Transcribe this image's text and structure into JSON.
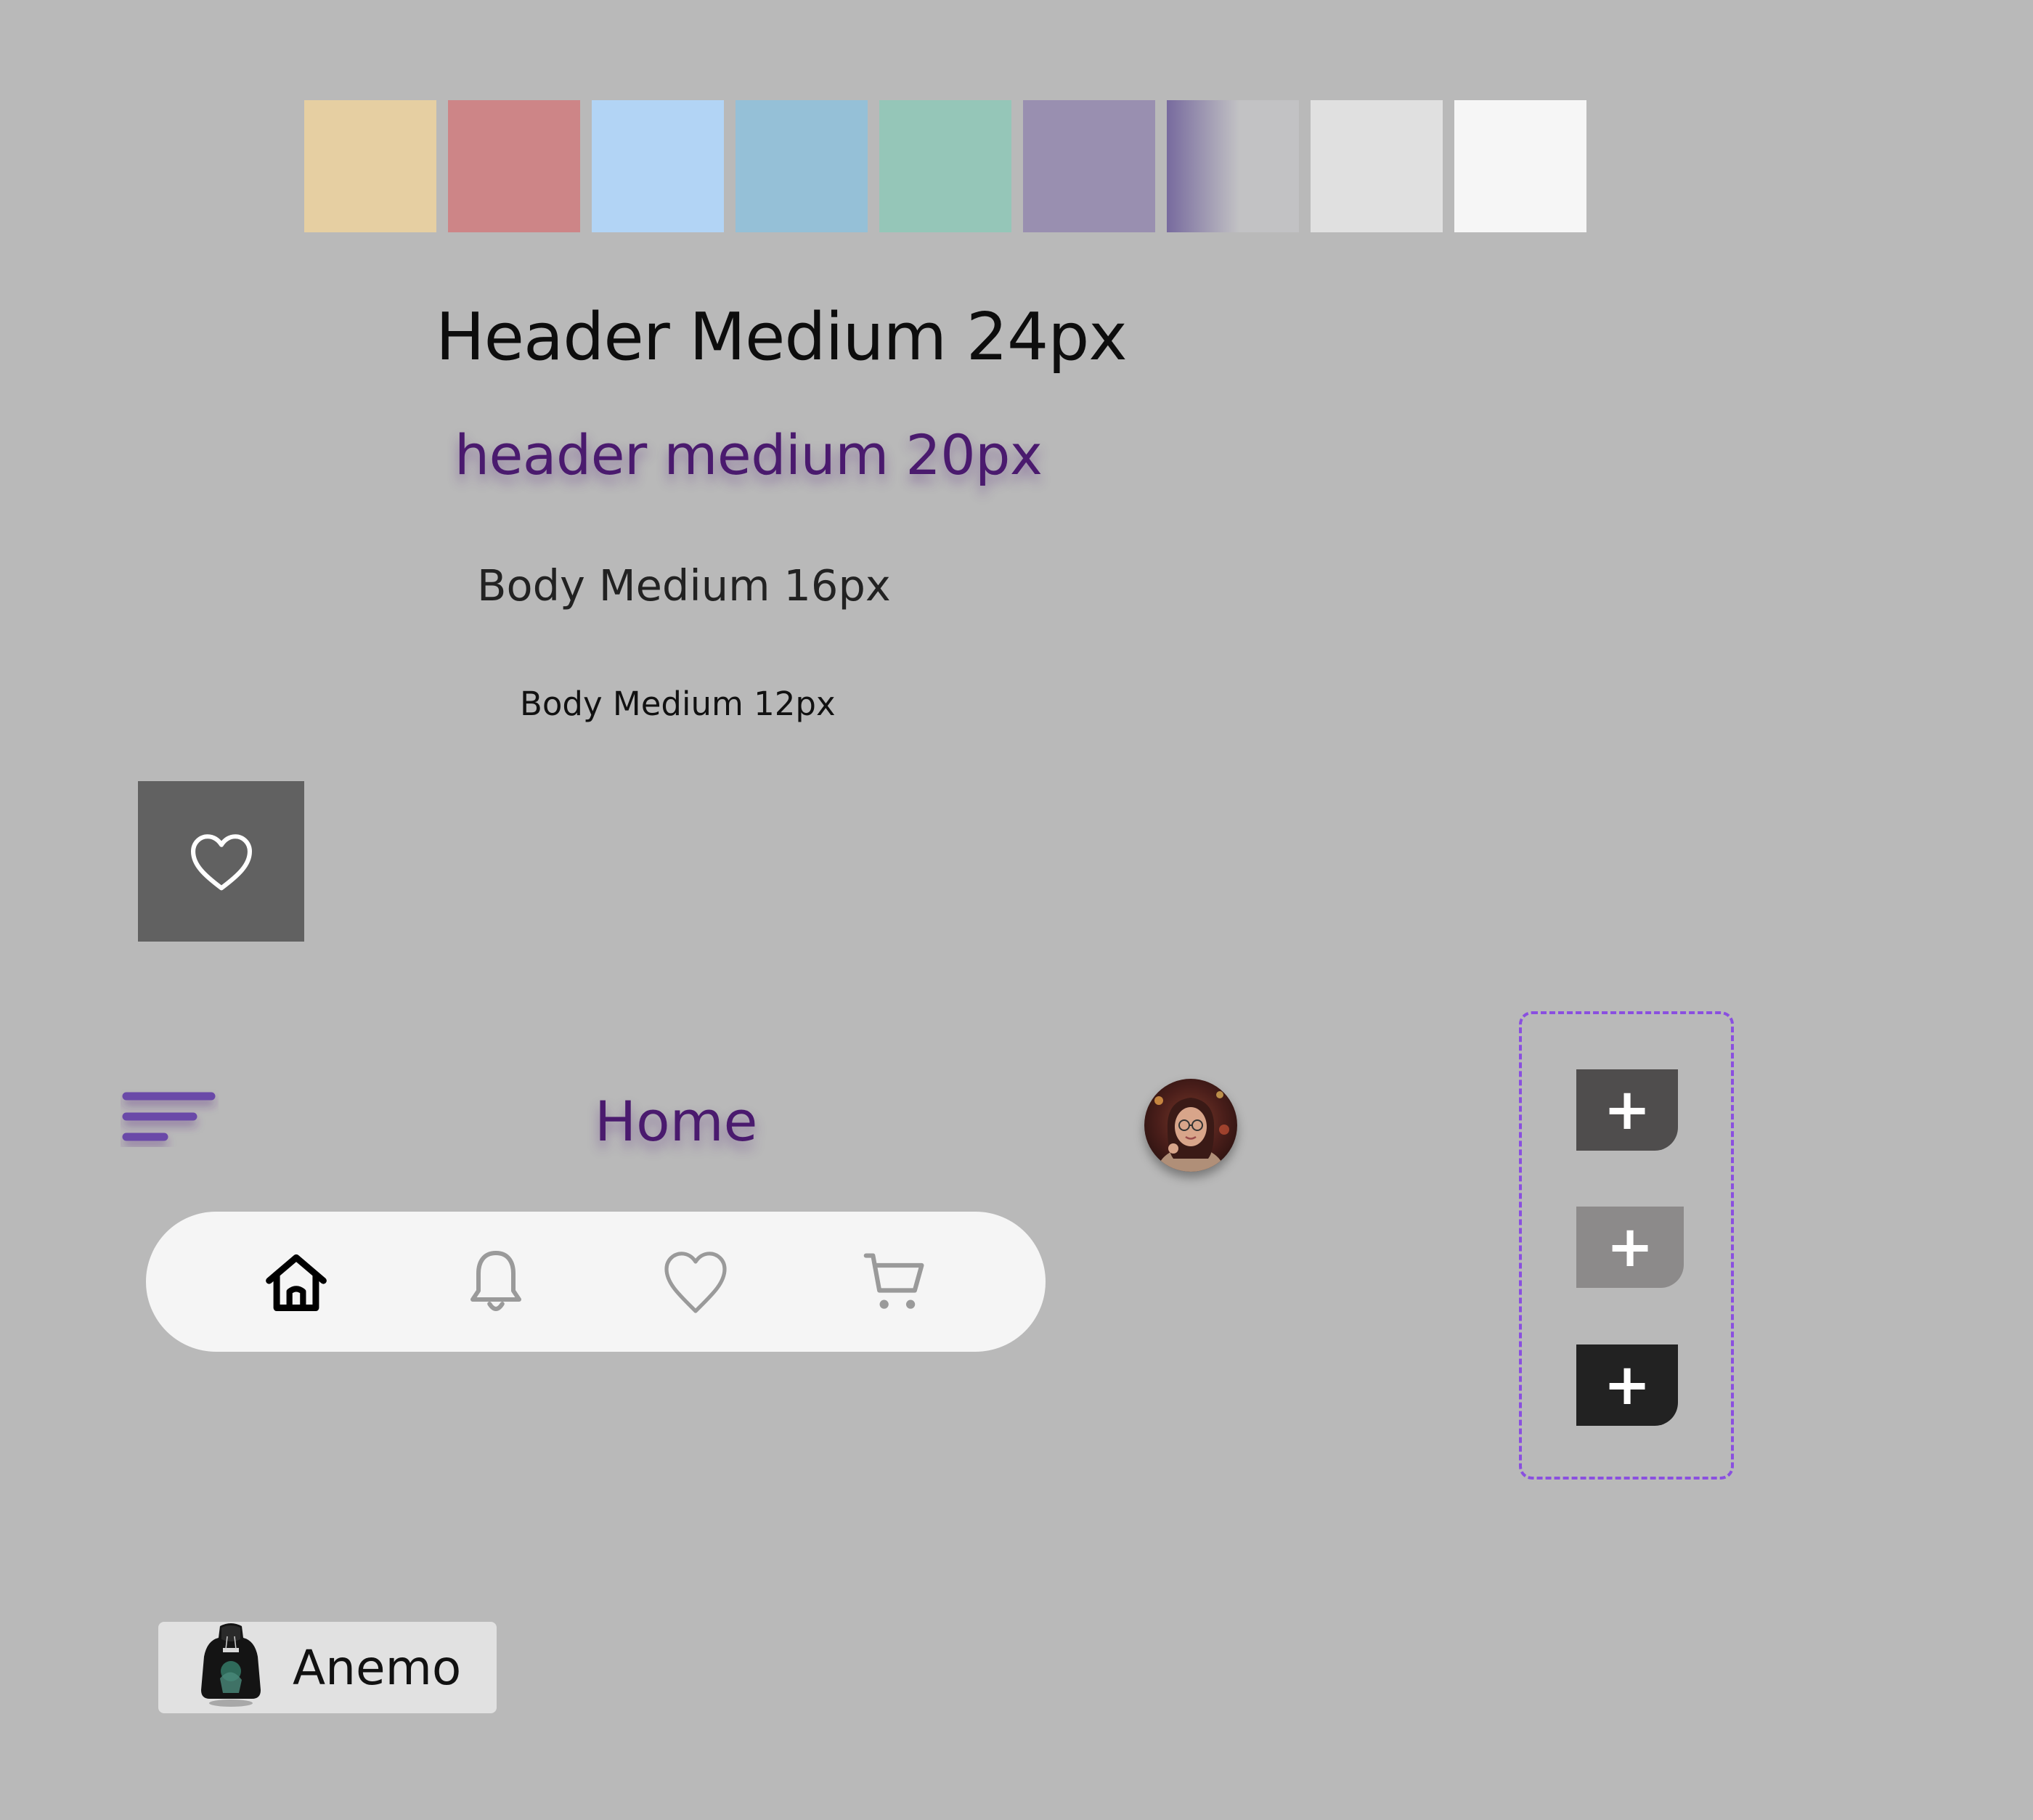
{
  "palette": [
    "#e6cfa2",
    "#cd8587",
    "#b2d4f5",
    "#95c0d7",
    "#95c6b8",
    "#998fb0",
    "gradient",
    "#e0e0e0",
    "#f6f6f6"
  ],
  "palette_gradient": {
    "from": "#776a9e",
    "to": "#c2c2c4"
  },
  "typography": {
    "header_24": "Header Medium 24px",
    "header_20": "header medium 20px",
    "body_16": "Body Medium 16px",
    "body_12": "Body Medium 12px"
  },
  "colors": {
    "accent_purple": "#4a1a6e",
    "menu_purple": "#6b4aa8",
    "variant_border": "#8a4fe0"
  },
  "favorite_tile": {
    "icon": "heart-outline-icon"
  },
  "header": {
    "title": "Home",
    "menu_icon": "menu-lines-icon",
    "avatar": "user-avatar"
  },
  "bottom_nav": {
    "items": [
      {
        "icon": "home-icon",
        "active": true
      },
      {
        "icon": "bell-icon",
        "active": false
      },
      {
        "icon": "heart-icon",
        "active": false
      },
      {
        "icon": "cart-icon",
        "active": false
      }
    ]
  },
  "add_buttons": [
    {
      "symbol": "+",
      "color": "#4f4d4d"
    },
    {
      "symbol": "+",
      "color": "#8c8a8a"
    },
    {
      "symbol": "+",
      "color": "#222222"
    }
  ],
  "chip": {
    "label": "Anemo",
    "thumbnail": "hoodie-thumbnail"
  }
}
